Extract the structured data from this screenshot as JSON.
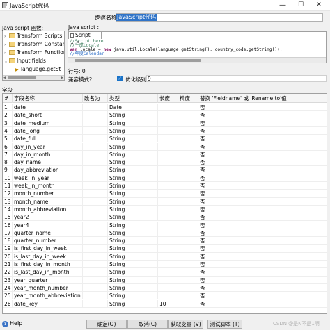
{
  "window": {
    "title": "JavaScript代码",
    "icon": "javascript-icon",
    "minimize": "—",
    "maximize": "☐",
    "close": "✕"
  },
  "step": {
    "label": "步骤名称",
    "value": "JavaScript代码"
  },
  "functions_panel": {
    "label": "Java script 函数:",
    "items": [
      {
        "label": "Transform Scripts",
        "expanded": false
      },
      {
        "label": "Transform Constants",
        "expanded": false
      },
      {
        "label": "Transform Functions",
        "expanded": false
      },
      {
        "label": "Input fields",
        "expanded": true
      },
      {
        "label": "language.getSt",
        "child": true
      }
    ]
  },
  "script_panel": {
    "label": "Java script :",
    "tab_label": "Script 1",
    "code_lines": [
      {
        "text": "//Script here",
        "kind": "comment"
      },
      {
        "text": "//生成Locale",
        "kind": "comment"
      },
      {
        "text": "var locale = new java.util.Locale(language.getString(), country_code.getString());",
        "kind": "code"
      },
      {
        "text": "//年度Calendar",
        "kind": "comment2"
      }
    ]
  },
  "line_no_label": "行号: 0",
  "compat_label": "兼容模式?",
  "optimize_label": "优化级别",
  "optimize_value": "9",
  "fields_label": "字段",
  "table": {
    "columns": [
      "#",
      "字段名称",
      "改名为",
      "类型",
      "长度",
      "精度",
      "替换 'Fieldname' 或 'Rename to'值"
    ],
    "rows": [
      [
        "1",
        "date",
        "",
        "Date",
        "",
        "",
        "否"
      ],
      [
        "2",
        "date_short",
        "",
        "String",
        "",
        "",
        "否"
      ],
      [
        "3",
        "date_medium",
        "",
        "String",
        "",
        "",
        "否"
      ],
      [
        "4",
        "date_long",
        "",
        "String",
        "",
        "",
        "否"
      ],
      [
        "5",
        "date_full",
        "",
        "String",
        "",
        "",
        "否"
      ],
      [
        "6",
        "day_in_year",
        "",
        "String",
        "",
        "",
        "否"
      ],
      [
        "7",
        "day_in_month",
        "",
        "String",
        "",
        "",
        "否"
      ],
      [
        "8",
        "day_name",
        "",
        "String",
        "",
        "",
        "否"
      ],
      [
        "9",
        "day_abbreviation",
        "",
        "String",
        "",
        "",
        "否"
      ],
      [
        "10",
        "week_in_year",
        "",
        "String",
        "",
        "",
        "否"
      ],
      [
        "11",
        "week_in_month",
        "",
        "String",
        "",
        "",
        "否"
      ],
      [
        "12",
        "month_number",
        "",
        "String",
        "",
        "",
        "否"
      ],
      [
        "13",
        "month_name",
        "",
        "String",
        "",
        "",
        "否"
      ],
      [
        "14",
        "month_abbreviation",
        "",
        "String",
        "",
        "",
        "否"
      ],
      [
        "15",
        "year2",
        "",
        "String",
        "",
        "",
        "否"
      ],
      [
        "16",
        "year4",
        "",
        "String",
        "",
        "",
        "否"
      ],
      [
        "17",
        "quarter_name",
        "",
        "String",
        "",
        "",
        "否"
      ],
      [
        "18",
        "quarter_number",
        "",
        "String",
        "",
        "",
        "否"
      ],
      [
        "19",
        "is_first_day_in_week",
        "",
        "String",
        "",
        "",
        "否"
      ],
      [
        "20",
        "is_last_day_in_week",
        "",
        "String",
        "",
        "",
        "否"
      ],
      [
        "21",
        "is_first_day_in_month",
        "",
        "String",
        "",
        "",
        "否"
      ],
      [
        "22",
        "is_last_day_in_month",
        "",
        "String",
        "",
        "",
        "否"
      ],
      [
        "23",
        "year_quarter",
        "",
        "String",
        "",
        "",
        "否"
      ],
      [
        "24",
        "year_month_number",
        "",
        "String",
        "",
        "",
        "否"
      ],
      [
        "25",
        "year_month_abbreviation",
        "",
        "String",
        "",
        "",
        "否"
      ],
      [
        "26",
        "date_key",
        "",
        "String",
        "10",
        "",
        "否"
      ]
    ]
  },
  "footer": {
    "help_label": "Help",
    "ok_label": "确定(O)",
    "cancel_label": "取消(C)",
    "get_vars_label": "获取变量 (V)",
    "test_label": "测试脚本 (T)",
    "watermark": "CSDN @是N不是1啊"
  },
  "colors": {
    "selection": "#3074c8",
    "checkbox": "#1a73c8",
    "comment": "#3f7f5f",
    "keyword": "#7f0055"
  }
}
